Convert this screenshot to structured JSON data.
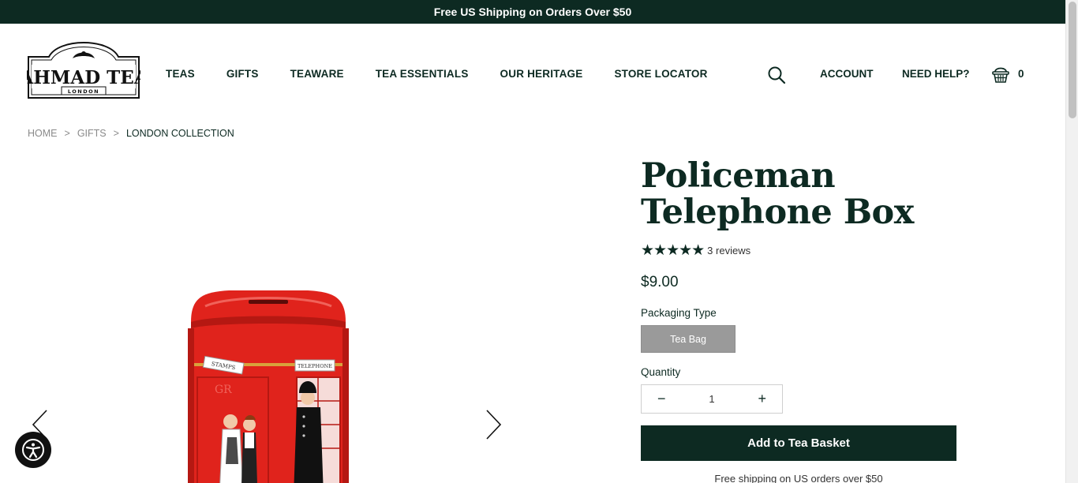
{
  "announcement": "Free US Shipping on Orders Over $50",
  "brand": {
    "logo_text": "AHMAD TEA",
    "logo_sub": "LONDON"
  },
  "nav": [
    "TEAS",
    "GIFTS",
    "TEAWARE",
    "TEA ESSENTIALS",
    "OUR HERITAGE",
    "STORE LOCATOR"
  ],
  "header": {
    "account": "ACCOUNT",
    "help": "NEED HELP?",
    "basket_count": "0"
  },
  "breadcrumb": {
    "home": "HOME",
    "sep": ">",
    "gifts": "GIFTS",
    "current": "LONDON COLLECTION"
  },
  "product": {
    "title_line1": "Policeman",
    "title_line2": "Telephone Box",
    "stars": "★★★★★",
    "rating": 5,
    "reviews": "3 reviews",
    "price": "$9.00",
    "packaging_label": "Packaging Type",
    "packaging_option": "Tea Bag",
    "quantity_label": "Quantity",
    "quantity_value": "1",
    "minus": "−",
    "plus": "+",
    "add_button": "Add to Tea Basket",
    "shipping_note": "Free shipping on US orders over $50"
  },
  "tin_labels": {
    "stamps": "STAMPS",
    "telephone": "TELEPHONE",
    "gr": "GR"
  },
  "colors": {
    "brand_dark": "#0d2a22",
    "option_grey": "#9a9a9a",
    "tin_red": "#e0231c"
  }
}
